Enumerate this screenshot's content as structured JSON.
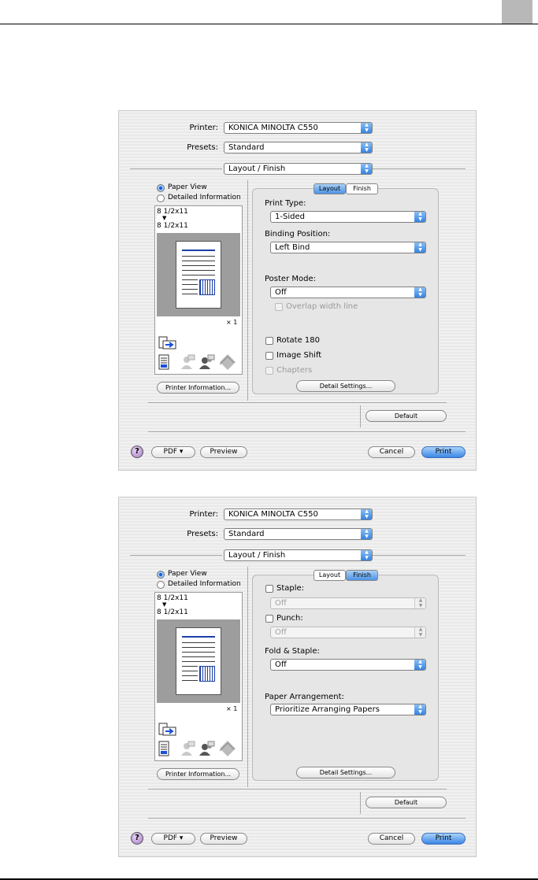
{
  "dialogs": [
    {
      "printer_label": "Printer:",
      "printer_value": "KONICA MINOLTA C550",
      "presets_label": "Presets:",
      "presets_value": "Standard",
      "pane_value": "Layout / Finish",
      "view_paper": "Paper View",
      "view_detail": "Detailed Information",
      "paper_size_top": "8 1/2x11",
      "paper_arrow": "▼",
      "paper_size_bottom": "8 1/2x11",
      "copies": "× 1",
      "printer_info_button": "Printer Information...",
      "tab_layout": "Layout",
      "tab_finish": "Finish",
      "active_tab": "Layout",
      "print_type_label": "Print Type:",
      "print_type_value": "1-Sided",
      "binding_label": "Binding Position:",
      "binding_value": "Left Bind",
      "poster_label": "Poster Mode:",
      "poster_value": "Off",
      "overlap_label": "Overlap width line",
      "rotate_label": "Rotate 180",
      "image_shift_label": "Image Shift",
      "chapters_label": "Chapters",
      "detail_settings_button": "Detail Settings...",
      "default_button": "Default",
      "pdf_button": "PDF ▾",
      "preview_button": "Preview",
      "cancel_button": "Cancel",
      "print_button": "Print",
      "help_button": "?"
    },
    {
      "printer_label": "Printer:",
      "printer_value": "KONICA MINOLTA C550",
      "presets_label": "Presets:",
      "presets_value": "Standard",
      "pane_value": "Layout / Finish",
      "view_paper": "Paper View",
      "view_detail": "Detailed Information",
      "paper_size_top": "8 1/2x11",
      "paper_arrow": "▼",
      "paper_size_bottom": "8 1/2x11",
      "copies": "× 1",
      "printer_info_button": "Printer Information...",
      "tab_layout": "Layout",
      "tab_finish": "Finish",
      "active_tab": "Finish",
      "staple_label": "Staple:",
      "staple_value": "Off",
      "punch_label": "Punch:",
      "punch_value": "Off",
      "fold_label": "Fold & Staple:",
      "fold_value": "Off",
      "arrangement_label": "Paper Arrangement:",
      "arrangement_value": "Prioritize Arranging Papers",
      "detail_settings_button": "Detail Settings...",
      "default_button": "Default",
      "pdf_button": "PDF ▾",
      "preview_button": "Preview",
      "cancel_button": "Cancel",
      "print_button": "Print",
      "help_button": "?"
    }
  ],
  "colors": {
    "accent": "#3b86e6",
    "selected_tab": "#4d94e6"
  },
  "icons": [
    "popup-arrows-icon",
    "radio-icon",
    "checkbox-icon",
    "help-icon",
    "printer-layout-icon",
    "document-icon",
    "users-icon",
    "stack-icon"
  ]
}
